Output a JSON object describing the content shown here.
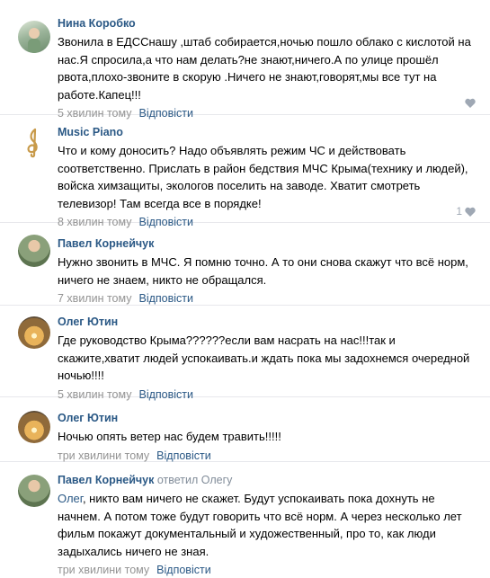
{
  "comments": [
    {
      "author": "Нина Коробко",
      "reply_to": "",
      "mention": "",
      "text": "Звонила в ЕДССнашу ,штаб собирается,ночью пошло облако с кислотой на нас.Я спросила,а что нам делать?не знают,ничего.А по улице прошёл рвота,плохо-звоните в скорую .Ничего не знают,говорят,мы все тут на работе.Капец!!!",
      "time": "5 хвилин тому",
      "reply_label": "Відповісти",
      "likes": ""
    },
    {
      "author": "Music Piano",
      "reply_to": "",
      "mention": "",
      "text": "Что и кому доносить? Надо объявлять режим ЧС и действовать соответственно. Прислать в район бедствия МЧС Крыма(технику и людей), войска химзащиты, экологов поселить на заводе. Хватит смотреть телевизор! Там всегда все в порядке!",
      "time": "8 хвилин тому",
      "reply_label": "Відповісти",
      "likes": "1"
    },
    {
      "author": "Павел Корнейчук",
      "reply_to": "",
      "mention": "",
      "text": "Нужно звонить в МЧС. Я помню точно. А то они снова скажут что всё норм, ничего не знаем, никто не обращался.",
      "time": "7 хвилин тому",
      "reply_label": "Відповісти",
      "likes": ""
    },
    {
      "author": "Олег Ютин",
      "reply_to": "",
      "mention": "",
      "text": "Где руководство Крыма??????если вам насрать на нас!!!так и скажите,хватит людей успокаивать.и ждать пока мы задохнемся очередной ночью!!!!",
      "time": "5 хвилин тому",
      "reply_label": "Відповісти",
      "likes": ""
    },
    {
      "author": "Олег Ютин",
      "reply_to": "",
      "mention": "",
      "text": "Ночью опять ветер нас будем травить!!!!!",
      "time": "три хвилини тому",
      "reply_label": "Відповісти",
      "likes": ""
    },
    {
      "author": "Павел Корнейчук",
      "reply_to": "ответил Олегу",
      "mention": "Олег",
      "text": ", никто вам ничего не скажет. Будут успокаивать пока дохнуть не начнем. А потом тоже будут говорить что всё норм. А через несколько лет фильм покажут документальный и художественный, про то, как люди задыхались ничего не зная.",
      "time": "три хвилини тому",
      "reply_label": "Відповісти",
      "likes": ""
    }
  ],
  "icons": {
    "like": "heart-icon",
    "avatar_music": "treble-clef-icon"
  },
  "colors": {
    "author": "#2a5885",
    "meta": "#939393",
    "divider": "#e7e8ec"
  }
}
